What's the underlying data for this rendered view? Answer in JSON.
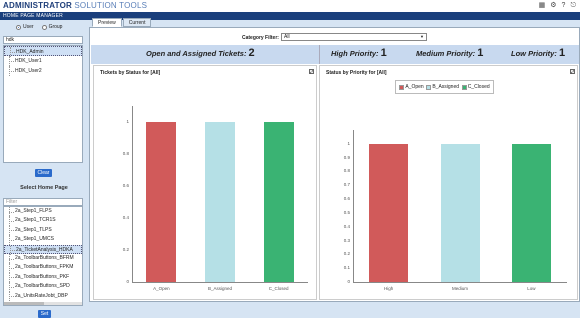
{
  "app": {
    "brand_bold": "ADMINISTRATOR",
    "brand_light": " SOLUTION TOOLS",
    "page": "HOME PAGE MANAGER"
  },
  "header_icons": [
    "grid-icon",
    "gear-icon",
    "help-icon",
    "logout-icon"
  ],
  "left": {
    "radio_user": "User",
    "radio_group": "Group",
    "selected_radio": "User",
    "name_input": "hdk",
    "users": [
      "HDK_Admin",
      "HDK_User1",
      "HDK_User2"
    ],
    "selected_user": "HDK_Admin",
    "clear_label": "Clear",
    "select_home_title": "Select Home Page",
    "filter_placeholder": "Filter",
    "home_pages": [
      "2a_Step1_FLPS",
      "2a_Step1_TCR1S",
      "2a_Step1_TLPS",
      "2a_Step1_UMCS",
      "2a_TicketAnalysis_HDKA",
      "2a_ToolbarButtons_BFRM",
      "2a_ToolbarButtons_FPKM",
      "2a_ToolbarButtons_PKF",
      "2a_ToolbarButtons_SPD",
      "2a_UnitsRateJobt_DBP"
    ],
    "selected_home_page": "2a_TicketAnalysis_HDKA",
    "set_label": "Set"
  },
  "tabs": [
    {
      "label": "Preview",
      "active": true
    },
    {
      "label": "Current",
      "active": false
    }
  ],
  "category_filter": {
    "label": "Category Filter:",
    "value": "All"
  },
  "summary": {
    "open_assigned_label": "Open and Assigned Tickets:",
    "open_assigned_value": "2",
    "high_label": "High Priority:",
    "high_value": "1",
    "medium_label": "Medium Priority:",
    "medium_value": "1",
    "low_label": "Low Priority:",
    "low_value": "1"
  },
  "chart_data": [
    {
      "type": "bar",
      "title": "Tickets by Status for [All]",
      "categories": [
        "A_Open",
        "B_Assigned",
        "C_Closed"
      ],
      "values": [
        1,
        1,
        1
      ],
      "colors": [
        "#d15a5a",
        "#b5e0e6",
        "#3ab373"
      ],
      "y_ticks": [
        "0",
        "0.2",
        "0.4",
        "0.6",
        "0.8",
        "1"
      ],
      "ylim": [
        0,
        1.1
      ],
      "grid": false
    },
    {
      "type": "bar",
      "title": "Status by Priority for [All]",
      "categories": [
        "High",
        "Medium",
        "Low"
      ],
      "values": [
        1,
        1,
        1
      ],
      "colors": [
        "#d15a5a",
        "#b5e0e6",
        "#3ab373"
      ],
      "legend": [
        "A_Open",
        "B_Assigned",
        "C_Closed"
      ],
      "legend_position": "top",
      "y_ticks": [
        "0",
        "0.1",
        "0.2",
        "0.3",
        "0.4",
        "0.5",
        "0.6",
        "0.7",
        "0.8",
        "0.9",
        "1"
      ],
      "ylim": [
        0,
        1.1
      ],
      "grid": false
    }
  ]
}
